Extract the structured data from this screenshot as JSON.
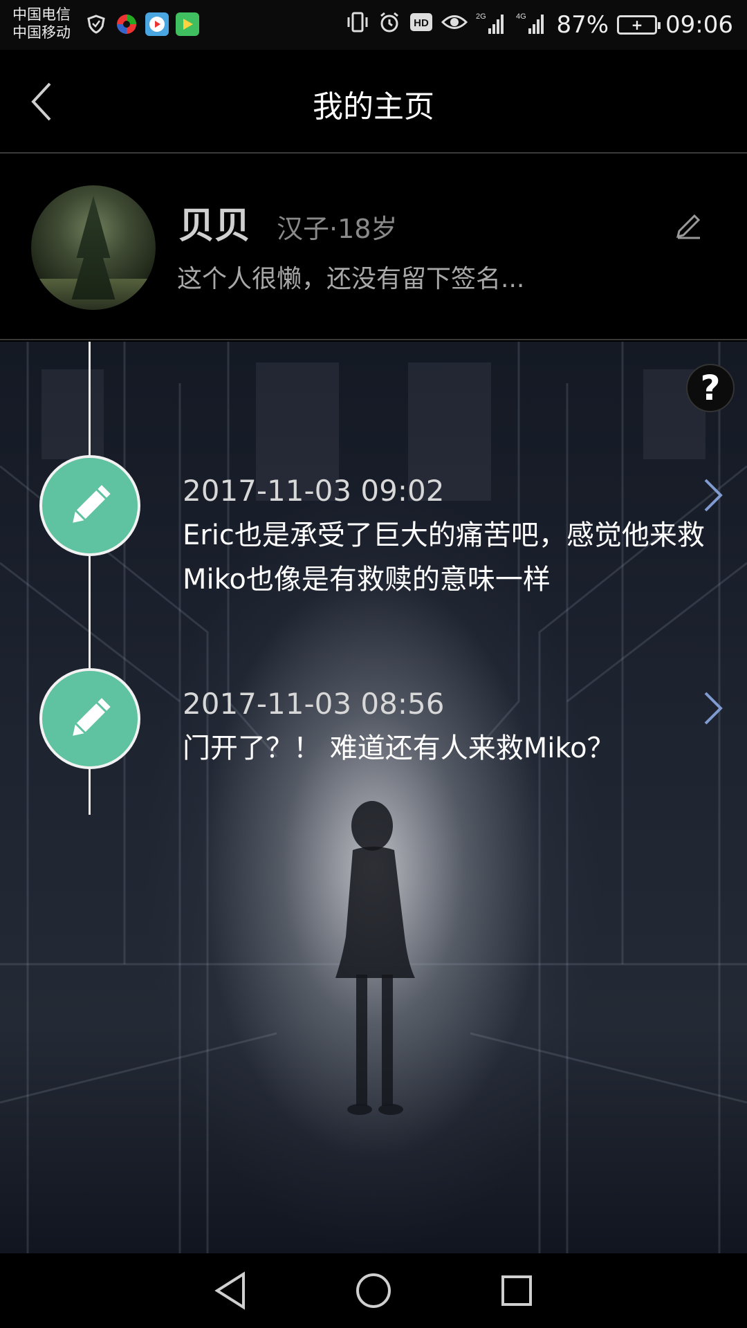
{
  "status_bar": {
    "carrier_1": "中国电信",
    "carrier_2": "中国移动",
    "left_icons": [
      "shield-icon",
      "pinwheel-icon",
      "video-app-icon",
      "play-app-icon"
    ],
    "signal_2g": "2G",
    "signal_4g": "4G",
    "battery_percent": "87%",
    "time": "09:06"
  },
  "header": {
    "title": "我的主页"
  },
  "profile": {
    "name": "贝贝",
    "meta": "汉子·18岁",
    "signature": "这个人很懒，还没有留下签名..."
  },
  "help": {
    "label": "?"
  },
  "timeline": [
    {
      "time": "2017-11-03 09:02",
      "text": "Eric也是承受了巨大的痛苦吧，感觉他来救Miko也像是有救赎的意味一样"
    },
    {
      "time": "2017-11-03 08:56",
      "text": "门开了？！ 难道还有人来救Miko？"
    }
  ],
  "colors": {
    "accent": "#5fc2a0",
    "arrow": "#7f9bd0"
  }
}
